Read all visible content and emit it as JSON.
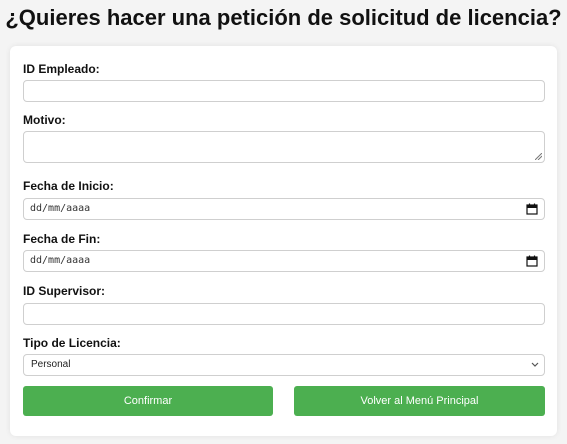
{
  "page": {
    "title": "¿Quieres hacer una petición de solicitud de licencia?"
  },
  "form": {
    "employee_id": {
      "label": "ID Empleado:",
      "value": ""
    },
    "reason": {
      "label": "Motivo:",
      "value": ""
    },
    "start_date": {
      "label": "Fecha de Inicio:",
      "placeholder": "dd/mm/aaaa",
      "icon": "calendar-icon"
    },
    "end_date": {
      "label": "Fecha de Fin:",
      "placeholder": "dd/mm/aaaa",
      "icon": "calendar-icon"
    },
    "supervisor_id": {
      "label": "ID Supervisor:",
      "value": ""
    },
    "leave_type": {
      "label": "Tipo de Licencia:",
      "selected": "Personal",
      "icon": "chevron-down-icon"
    }
  },
  "buttons": {
    "confirm": "Confirmar",
    "back": "Volver al Menú Principal"
  },
  "colors": {
    "button_green": "#4caf50",
    "page_background": "#f4f4f4",
    "card_background": "#ffffff"
  }
}
